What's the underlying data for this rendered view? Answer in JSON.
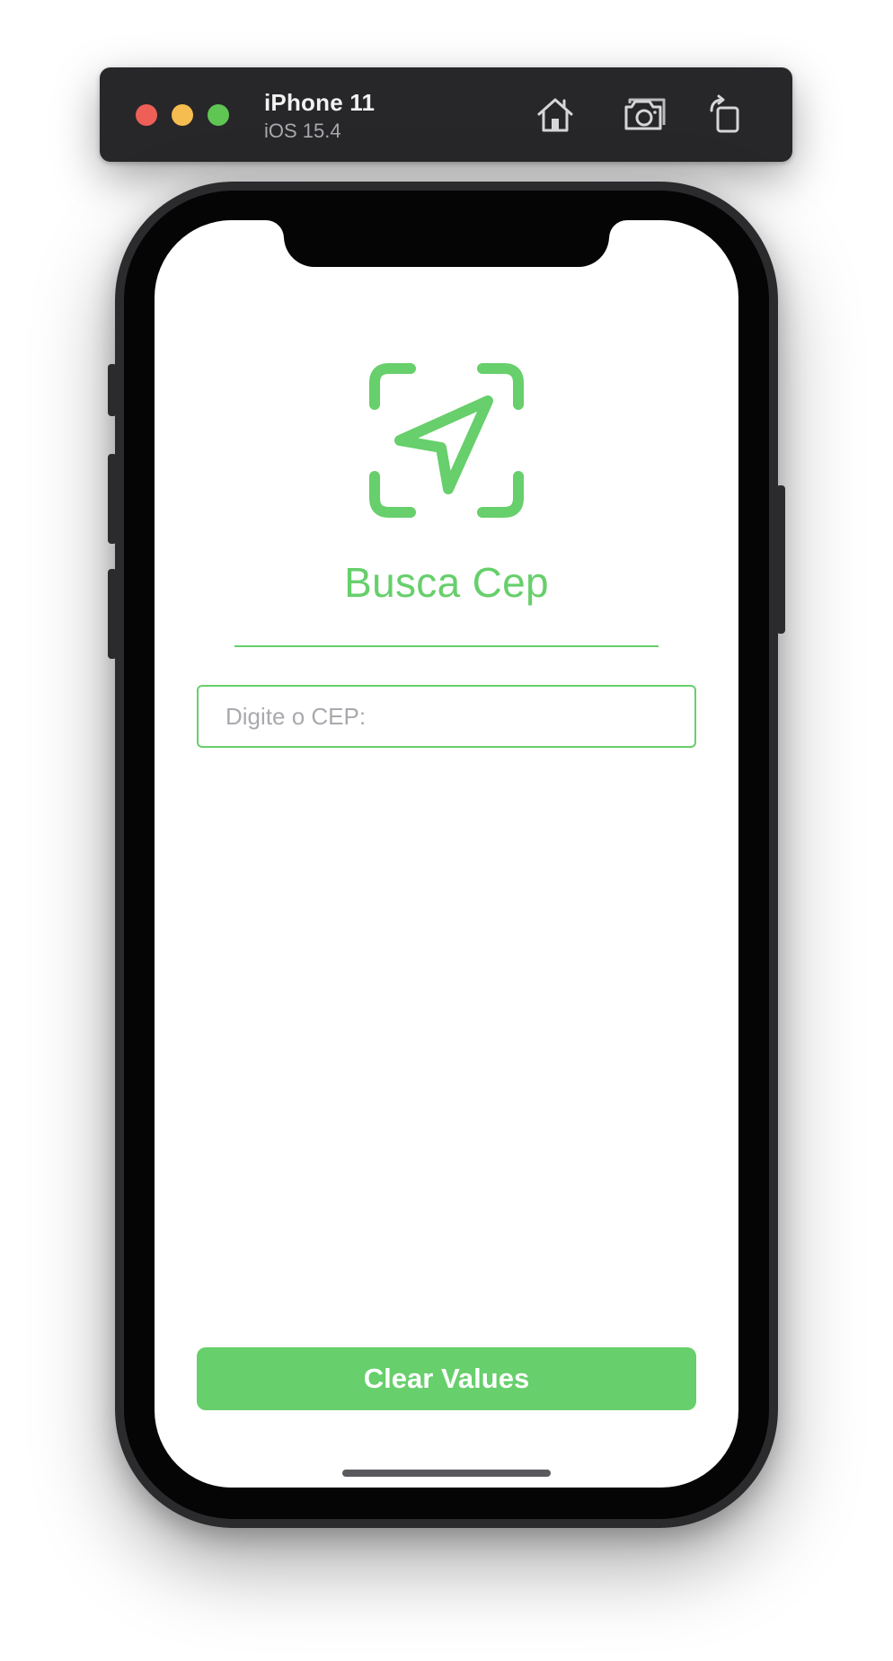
{
  "simulator": {
    "device_name": "iPhone 11",
    "os_version": "iOS 15.4",
    "controls": [
      {
        "icon": "home-icon"
      },
      {
        "icon": "screenshot-icon"
      },
      {
        "icon": "rotate-icon"
      }
    ]
  },
  "app": {
    "logo_icon": "location-arrow-scan-icon",
    "title": "Busca Cep",
    "cep_input": {
      "placeholder": "Digite o CEP:",
      "value": ""
    },
    "clear_button_label": "Clear Values"
  },
  "colors": {
    "accent": "#67cf6b",
    "toolbar_bg": "#27272a",
    "traffic_close": "#ee5f57",
    "traffic_minimize": "#f5bd4f",
    "traffic_zoom": "#5fc553"
  }
}
